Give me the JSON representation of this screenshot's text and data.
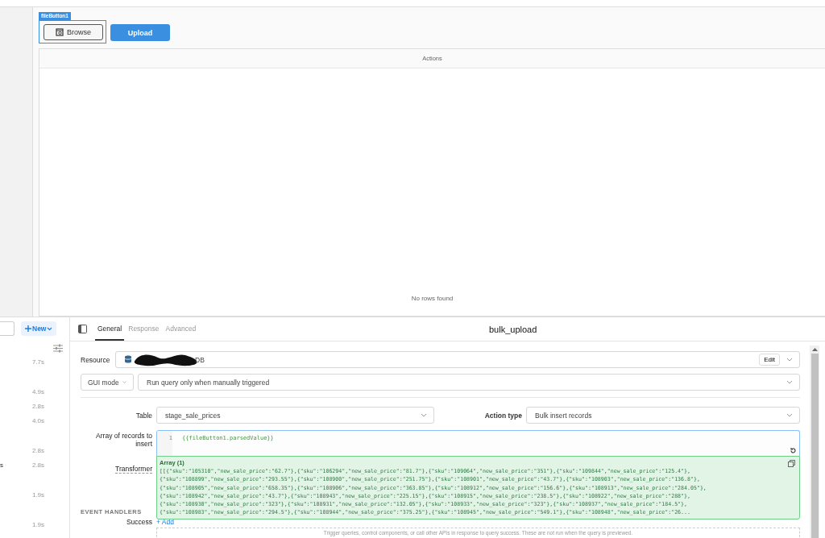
{
  "canvas": {
    "component_tag": "fileButton1",
    "browse_button": "Browse",
    "upload_button": "Upload",
    "table": {
      "columns": [
        "Actions"
      ],
      "empty_text": "No rows found"
    }
  },
  "query_list": {
    "new_button": "New",
    "items": [
      {
        "duration": "7.7s"
      },
      {
        "duration": "4.9s"
      },
      {
        "duration": "2.8s"
      },
      {
        "duration": "4.0s"
      },
      {
        "duration": "2.8s"
      },
      {
        "name": "s",
        "duration": "2.8s"
      },
      {
        "duration": "1.9s"
      },
      {
        "duration": "1.9s"
      }
    ]
  },
  "query_editor": {
    "tabs": [
      {
        "label": "General",
        "selected": true
      },
      {
        "label": "Response",
        "selected": false
      },
      {
        "label": "Advanced",
        "selected": false
      }
    ],
    "title": "bulk_upload",
    "resource": {
      "label": "Resource",
      "value": "DB",
      "edit_button": "Edit"
    },
    "mode": "GUI mode",
    "trigger": "Run query only when manually triggered",
    "table": {
      "label": "Table",
      "value": "stage_sale_prices"
    },
    "action_type": {
      "label": "Action type",
      "value": "Bulk insert records"
    },
    "records": {
      "label": "Array of records to insert",
      "line_number": "1",
      "code": "{{fileButton1.parsedValue}}",
      "preview_title": "Array (1)",
      "preview_lines": [
        "[[{\"sku\":\"105310\",\"new_sale_price\":\"62.7\"},{\"sku\":\"106294\",\"new_sale_price\":\"81.7\"},{\"sku\":\"109064\",\"new_sale_price\":\"351\"},{\"sku\":\"109844\",\"new_sale_price\":\"125.4\"},",
        "{\"sku\":\"108899\",\"new_sale_price\":\"293.55\"},{\"sku\":\"108900\",\"new_sale_price\":\"251.75\"},{\"sku\":\"108901\",\"new_sale_price\":\"43.7\"},{\"sku\":\"108903\",\"new_sale_price\":\"136.8\"},",
        "{\"sku\":\"108905\",\"new_sale_price\":\"658.35\"},{\"sku\":\"108906\",\"new_sale_price\":\"363.85\"},{\"sku\":\"108912\",\"new_sale_price\":\"156.6\"},{\"sku\":\"108913\",\"new_sale_price\":\"284.05\"},",
        "{\"sku\":\"108942\",\"new_sale_price\":\"43.7\"},{\"sku\":\"108943\",\"new_sale_price\":\"225.15\"},{\"sku\":\"108915\",\"new_sale_price\":\"238.5\"},{\"sku\":\"108922\",\"new_sale_price\":\"288\"},",
        "{\"sku\":\"108930\",\"new_sale_price\":\"323\"},{\"sku\":\"108931\",\"new_sale_price\":\"132.05\"},{\"sku\":\"108933\",\"new_sale_price\":\"323\"},{\"sku\":\"108937\",\"new_sale_price\":\"184.5\"},",
        "{\"sku\":\"108983\",\"new_sale_price\":\"294.5\"},{\"sku\":\"108944\",\"new_sale_price\":\"375.25\"},{\"sku\":\"108945\",\"new_sale_price\":\"549.1\"},{\"sku\":\"108948\",\"new_sale_price\":\"26..."
      ]
    },
    "transformer_label": "Transformer",
    "event_handlers": {
      "heading": "EVENT HANDLERS",
      "success_label": "Success",
      "add_link": "+ Add",
      "hint": "Trigger queries, control components, or call other APIs in response to query success. These are not run when the query is previewed."
    }
  }
}
